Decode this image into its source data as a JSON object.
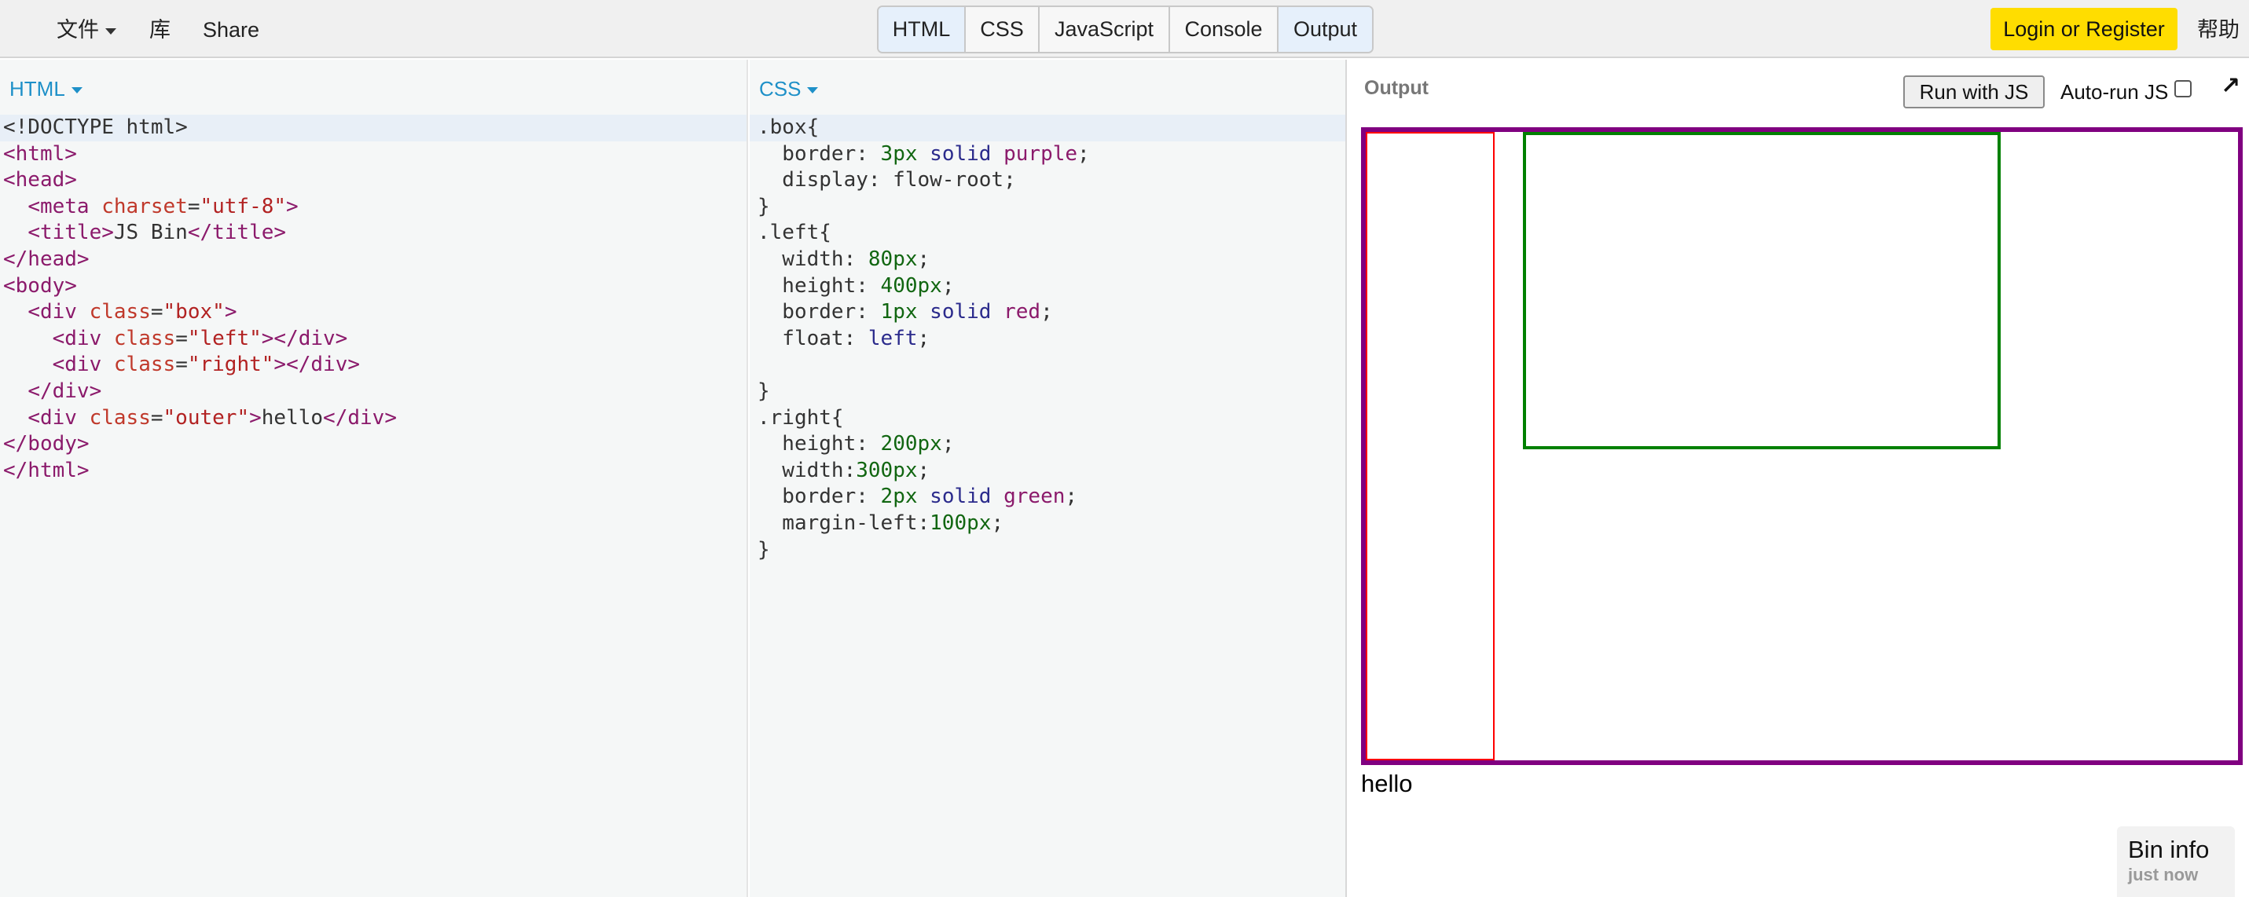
{
  "topbar": {
    "file_menu": "文件",
    "library": "库",
    "share": "Share",
    "tabs": [
      {
        "label": "HTML",
        "active": true
      },
      {
        "label": "CSS",
        "active": false
      },
      {
        "label": "JavaScript",
        "active": false
      },
      {
        "label": "Console",
        "active": false
      },
      {
        "label": "Output",
        "active": true
      }
    ],
    "login": "Login or Register",
    "help": "帮助"
  },
  "html_panel": {
    "label": "HTML",
    "code_lines": [
      [
        [
          "t-plain",
          "<!DOCTYPE html>"
        ]
      ],
      [
        [
          "t-tag",
          "<html>"
        ]
      ],
      [
        [
          "t-tag",
          "<head>"
        ]
      ],
      [
        [
          "t-plain",
          "  "
        ],
        [
          "t-tag",
          "<meta "
        ],
        [
          "t-attr",
          "charset"
        ],
        [
          "t-plain",
          "="
        ],
        [
          "t-str",
          "\"utf-8\""
        ],
        [
          "t-tag",
          ">"
        ]
      ],
      [
        [
          "t-plain",
          "  "
        ],
        [
          "t-tag",
          "<title>"
        ],
        [
          "t-plain",
          "JS Bin"
        ],
        [
          "t-tag",
          "</title>"
        ]
      ],
      [
        [
          "t-tag",
          "</head>"
        ]
      ],
      [
        [
          "t-tag",
          "<body>"
        ]
      ],
      [
        [
          "t-plain",
          "  "
        ],
        [
          "t-tag",
          "<div "
        ],
        [
          "t-attr",
          "class"
        ],
        [
          "t-plain",
          "="
        ],
        [
          "t-str",
          "\"box\""
        ],
        [
          "t-tag",
          ">"
        ]
      ],
      [
        [
          "t-plain",
          "    "
        ],
        [
          "t-tag",
          "<div "
        ],
        [
          "t-attr",
          "class"
        ],
        [
          "t-plain",
          "="
        ],
        [
          "t-str",
          "\"left\""
        ],
        [
          "t-tag",
          "></div>"
        ]
      ],
      [
        [
          "t-plain",
          "    "
        ],
        [
          "t-tag",
          "<div "
        ],
        [
          "t-attr",
          "class"
        ],
        [
          "t-plain",
          "="
        ],
        [
          "t-str",
          "\"right\""
        ],
        [
          "t-tag",
          "></div>"
        ]
      ],
      [
        [
          "t-plain",
          "  "
        ],
        [
          "t-tag",
          "</div>"
        ]
      ],
      [
        [
          "t-plain",
          "  "
        ],
        [
          "t-tag",
          "<div "
        ],
        [
          "t-attr",
          "class"
        ],
        [
          "t-plain",
          "="
        ],
        [
          "t-str",
          "\"outer\""
        ],
        [
          "t-tag",
          ">"
        ],
        [
          "t-plain",
          "hello"
        ],
        [
          "t-tag",
          "</div>"
        ]
      ],
      [
        [
          "t-tag",
          "</body>"
        ]
      ],
      [
        [
          "t-tag",
          "</html>"
        ]
      ]
    ]
  },
  "css_panel": {
    "label": "CSS",
    "code_lines": [
      [
        [
          "t-plain",
          ".box{"
        ]
      ],
      [
        [
          "t-plain",
          "  border: "
        ],
        [
          "t-num",
          "3px"
        ],
        [
          "t-plain",
          " "
        ],
        [
          "t-kw",
          "solid"
        ],
        [
          "t-plain",
          " "
        ],
        [
          "t-tag",
          "purple"
        ],
        [
          "t-plain",
          ";"
        ]
      ],
      [
        [
          "t-plain",
          "  display: flow-root;"
        ]
      ],
      [
        [
          "t-plain",
          "}"
        ]
      ],
      [
        [
          "t-plain",
          ".left{"
        ]
      ],
      [
        [
          "t-plain",
          "  width: "
        ],
        [
          "t-num",
          "80px"
        ],
        [
          "t-plain",
          ";"
        ]
      ],
      [
        [
          "t-plain",
          "  height: "
        ],
        [
          "t-num",
          "400px"
        ],
        [
          "t-plain",
          ";"
        ]
      ],
      [
        [
          "t-plain",
          "  border: "
        ],
        [
          "t-num",
          "1px"
        ],
        [
          "t-plain",
          " "
        ],
        [
          "t-kw",
          "solid"
        ],
        [
          "t-plain",
          " "
        ],
        [
          "t-tag",
          "red"
        ],
        [
          "t-plain",
          ";"
        ]
      ],
      [
        [
          "t-plain",
          "  float: "
        ],
        [
          "t-kw",
          "left"
        ],
        [
          "t-plain",
          ";"
        ]
      ],
      [
        [
          "t-plain",
          ""
        ]
      ],
      [
        [
          "t-plain",
          "}"
        ]
      ],
      [
        [
          "t-plain",
          ".right{"
        ]
      ],
      [
        [
          "t-plain",
          "  height: "
        ],
        [
          "t-num",
          "200px"
        ],
        [
          "t-plain",
          ";"
        ]
      ],
      [
        [
          "t-plain",
          "  width:"
        ],
        [
          "t-num",
          "300px"
        ],
        [
          "t-plain",
          ";"
        ]
      ],
      [
        [
          "t-plain",
          "  border: "
        ],
        [
          "t-num",
          "2px"
        ],
        [
          "t-plain",
          " "
        ],
        [
          "t-kw",
          "solid"
        ],
        [
          "t-plain",
          " "
        ],
        [
          "t-tag",
          "green"
        ],
        [
          "t-plain",
          ";"
        ]
      ],
      [
        [
          "t-plain",
          "  margin-left:"
        ],
        [
          "t-num",
          "100px"
        ],
        [
          "t-plain",
          ";"
        ]
      ],
      [
        [
          "t-plain",
          "}"
        ]
      ]
    ]
  },
  "output_panel": {
    "title": "Output",
    "run_button": "Run with JS",
    "autorun_label": "Auto-run JS",
    "autorun_checked": false,
    "popout_icon": "arrow-up-right-icon",
    "demo_text": "hello",
    "bin_info_title": "Bin info",
    "bin_info_sub": "just now"
  },
  "colors": {
    "purple_border": "#800080",
    "red_border": "#ff0000",
    "green_border": "#008000",
    "login_bg": "#ffdd00",
    "panel_label": "#1e90c8"
  }
}
